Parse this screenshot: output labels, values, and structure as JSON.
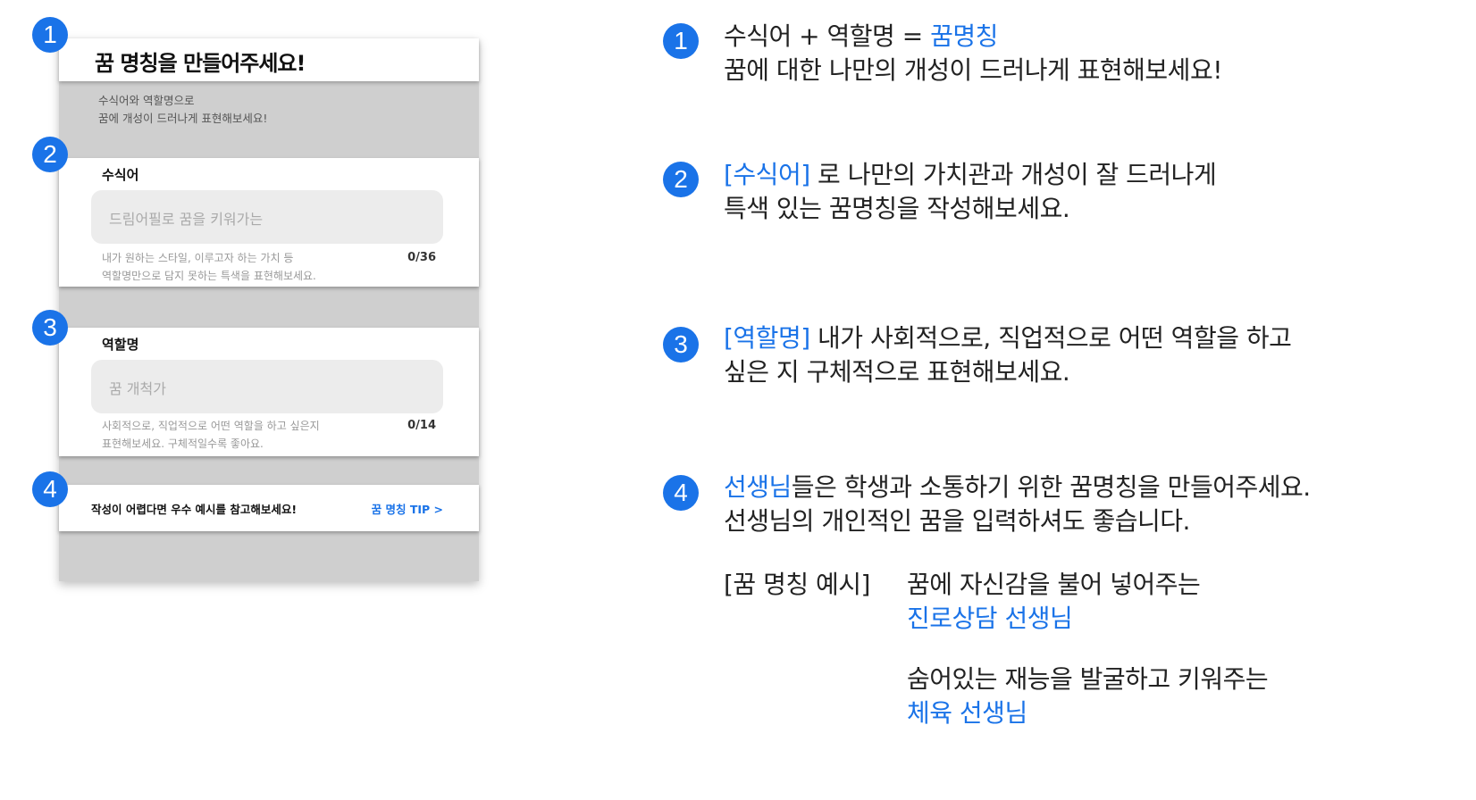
{
  "mock": {
    "title": "꿈 명칭을 만들어주세요!",
    "intro_line1": "수식어와 역할명으로",
    "intro_line2": "꿈에 개성이 드러나게 표현해보세요!",
    "modifier": {
      "label": "수식어",
      "placeholder": "드림어필로 꿈을 키워가는",
      "help_line1": "내가 원하는 스타일, 이루고자 하는 가치 등",
      "help_line2": "역할명만으로 담지 못하는 특색을 표현해보세요.",
      "counter": "0/36"
    },
    "role": {
      "label": "역할명",
      "placeholder": "꿈 개척가",
      "help_line1": "사회적으로, 직업적으로 어떤 역할을 하고 싶은지",
      "help_line2": "표현해보세요. 구체적일수록 좋아요.",
      "counter": "0/14"
    },
    "tip_text": "작성이 어렵다면 우수 예시를 참고해보세요!",
    "tip_link": "꿈 명칭 TIP >"
  },
  "badges": [
    "1",
    "2",
    "3",
    "4"
  ],
  "explanations": {
    "e1": {
      "part1": "수식어 + 역할명 = ",
      "part1_blue": "꿈명칭",
      "line2": "꿈에 대한 나만의 개성이 드러나게 표현해보세요!"
    },
    "e2": {
      "blue": "[수식어]",
      "rest": " 로 나만의 가치관과 개성이 잘 드러나게",
      "line2": "특색 있는 꿈명칭을 작성해보세요."
    },
    "e3": {
      "blue": "[역할명]",
      "rest": " 내가 사회적으로, 직업적으로 어떤 역할을 하고",
      "line2": "싶은 지 구체적으로 표현해보세요."
    },
    "e4": {
      "blue": "선생님",
      "rest": "들은 학생과 소통하기 위한 꿈명칭을 만들어주세요.",
      "line2": "선생님의 개인적인 꿈을 입력하셔도 좋습니다.",
      "example_label": "[꿈 명칭 예시]",
      "ex1_line1": "꿈에 자신감을 불어 넣어주는",
      "ex1_line2": "진로상담 선생님",
      "ex2_line1": "숨어있는 재능을 발굴하고 키워주는",
      "ex2_line2": "체육 선생님"
    }
  },
  "colors": {
    "accent": "#1a73e8",
    "overlay": "#cfcfcf"
  }
}
